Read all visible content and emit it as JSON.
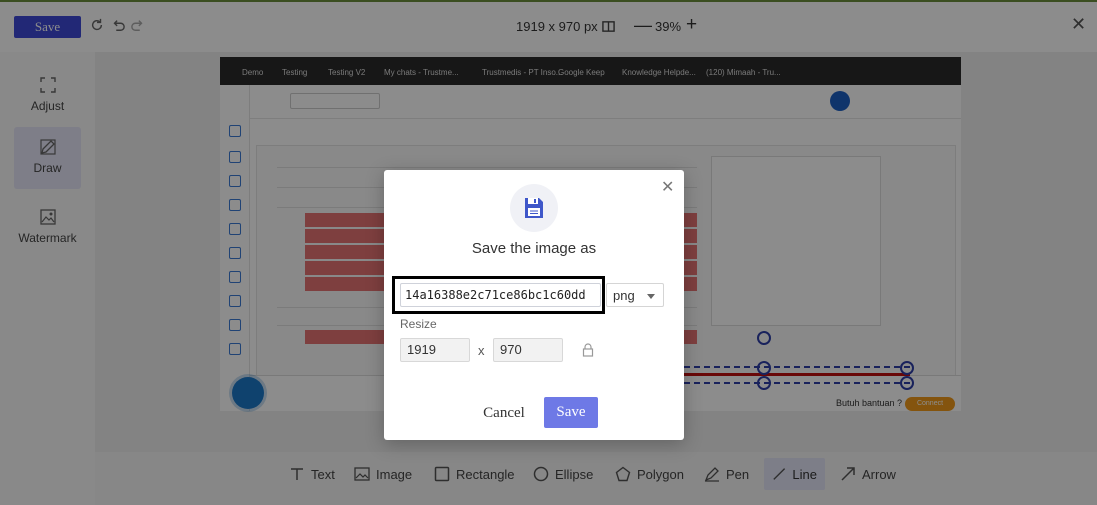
{
  "toolbar": {
    "save_label": "Save",
    "dimensions": "1919 x 970 px",
    "zoom_level": "39%"
  },
  "sidebar": {
    "items": [
      {
        "label": "Adjust",
        "icon": "adjust-icon"
      },
      {
        "label": "Draw",
        "icon": "pencil-icon"
      },
      {
        "label": "Watermark",
        "icon": "image-icon"
      }
    ]
  },
  "tools": [
    {
      "label": "Text",
      "icon": "text-icon"
    },
    {
      "label": "Image",
      "icon": "image-icon"
    },
    {
      "label": "Rectangle",
      "icon": "rectangle-icon"
    },
    {
      "label": "Ellipse",
      "icon": "ellipse-icon"
    },
    {
      "label": "Polygon",
      "icon": "polygon-icon"
    },
    {
      "label": "Pen",
      "icon": "pen-icon"
    },
    {
      "label": "Line",
      "icon": "line-icon"
    },
    {
      "label": "Arrow",
      "icon": "arrow-icon"
    }
  ],
  "screenshot": {
    "bookmarks": [
      "Demo",
      "Testing",
      "Testing V2",
      "My chats - Trustme...",
      "Trustmedis - PT Inso...",
      "Google Keep",
      "Knowledge Helpde...",
      "(120) Mimaah - Tru..."
    ],
    "help_text": "Butuh bantuan ?",
    "connect_label": "Connect"
  },
  "modal": {
    "title": "Save the image as",
    "filename": "14a16388e2c71ce86bc1c60dd",
    "format": "png",
    "resize_label": "Resize",
    "width": "1919",
    "height": "970",
    "x_separator": "x",
    "cancel_label": "Cancel",
    "save_label": "Save"
  },
  "colors": {
    "accent": "#3f4ad8",
    "save_button": "#6e79e6",
    "active_tool_bg": "#e3e5f7"
  }
}
